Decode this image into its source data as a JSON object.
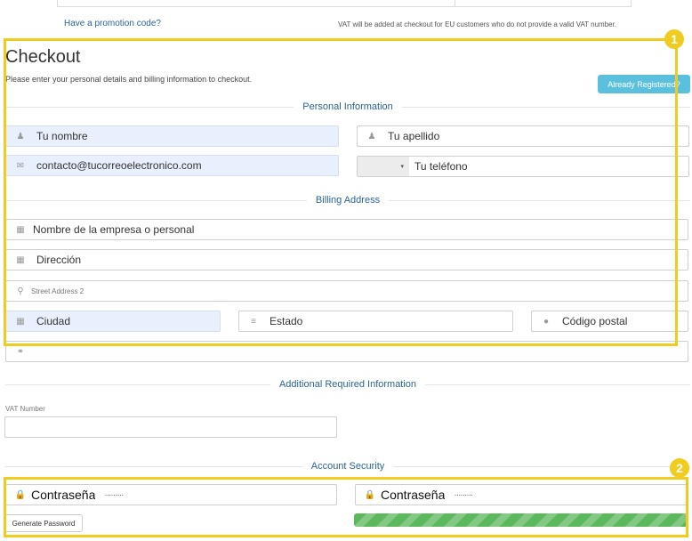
{
  "top": {
    "promo_link": "Have a promotion code?",
    "vat_note": "VAT will be added at checkout for EU customers who do not provide a valid VAT number."
  },
  "checkout": {
    "title": "Checkout",
    "subtitle": "Please enter your personal details and billing information to checkout.",
    "already_registered": "Already Registered?"
  },
  "sections": {
    "personal": "Personal Information",
    "billing": "Billing Address",
    "additional": "Additional Required Information",
    "security": "Account Security"
  },
  "personal": {
    "first_name": "Tu nombre",
    "last_name": "Tu apellido",
    "email": "contacto@tucorreoelectronico.com",
    "phone": "Tu teléfono"
  },
  "billing": {
    "company": "Nombre de la empresa o personal",
    "address1": "Dirección",
    "address2_placeholder": "Street Address 2",
    "city": "Ciudad",
    "state": "Estado",
    "postcode": "Código postal"
  },
  "additional": {
    "vat_label": "VAT Number",
    "vat_value": ""
  },
  "security": {
    "password_label": "Contraseña",
    "password_dots": "·········",
    "confirm_label": "Contraseña",
    "confirm_dots": "·········",
    "generate_button": "Generate Password",
    "strength_percent": 100
  },
  "badges": {
    "one": "1",
    "two": "2"
  },
  "colors": {
    "accent": "#2a6496",
    "info_button": "#5bc0de",
    "highlight": "#f0cc1e",
    "strength_bar": "#5cb85c",
    "autofill": "#e8f0fe"
  },
  "icons": [
    "user-icon",
    "envelope-icon",
    "building-icon",
    "map-marker-icon",
    "state-icon",
    "postcode-icon",
    "globe-icon",
    "lock-icon"
  ]
}
